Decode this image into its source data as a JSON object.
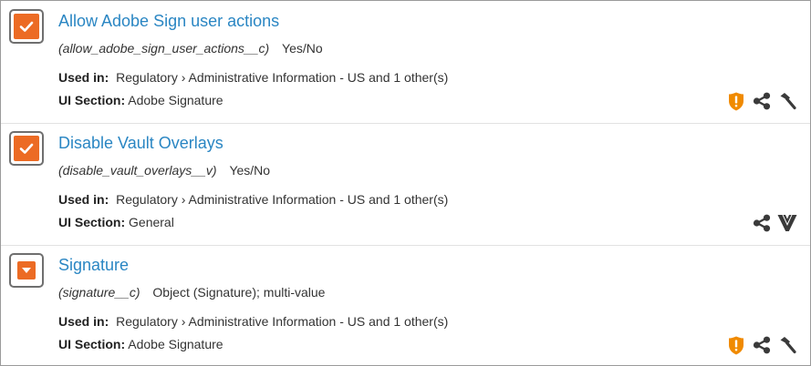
{
  "fields": [
    {
      "label": "Allow Adobe Sign user actions",
      "api_name": "(allow_adobe_sign_user_actions__c)",
      "data_type": "Yes/No",
      "used_in_label": "Used in:",
      "used_in_value": "Regulatory › Administrative Information - US and 1 other(s)",
      "ui_section_label": "UI Section:",
      "ui_section_value": "Adobe Signature",
      "type_icon": "checkbox-icon",
      "action_icons": [
        "shield-alert-icon",
        "share-icon",
        "hammer-icon"
      ]
    },
    {
      "label": "Disable Vault Overlays",
      "api_name": "(disable_vault_overlays__v)",
      "data_type": "Yes/No",
      "used_in_label": "Used in:",
      "used_in_value": "Regulatory › Administrative Information - US and 1 other(s)",
      "ui_section_label": "UI Section:",
      "ui_section_value": "General",
      "type_icon": "checkbox-icon",
      "action_icons": [
        "share-icon",
        "vault-logo-icon"
      ]
    },
    {
      "label": "Signature",
      "api_name": "(signature__c)",
      "data_type": "Object (Signature); multi-value",
      "used_in_label": "Used in:",
      "used_in_value": "Regulatory › Administrative Information - US and 1 other(s)",
      "ui_section_label": "UI Section:",
      "ui_section_value": "Adobe Signature",
      "type_icon": "dropdown-icon",
      "action_icons": [
        "shield-alert-icon",
        "share-icon",
        "hammer-icon"
      ]
    }
  ],
  "colors": {
    "accent_orange": "#ec6b24",
    "link_blue": "#2a86c3",
    "icon_gray": "#3a3a3a",
    "shield_orange": "#f08a00"
  }
}
